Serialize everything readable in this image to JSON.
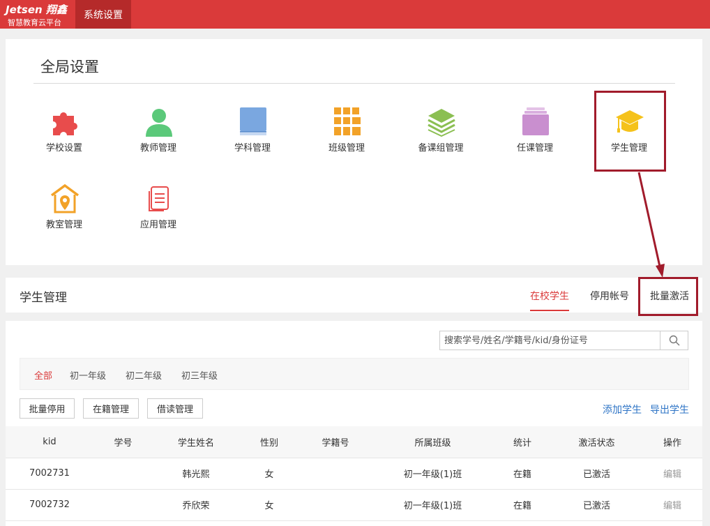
{
  "header": {
    "brand": "Jetsen 翔鑫",
    "subtitle": "智慧教育云平台",
    "nav_tab": "系统设置"
  },
  "global": {
    "title": "全局设置",
    "tiles": [
      {
        "label": "学校设置",
        "icon": "puzzle-icon",
        "color": "#e84c4c"
      },
      {
        "label": "教师管理",
        "icon": "user-icon",
        "color": "#5bc97a"
      },
      {
        "label": "学科管理",
        "icon": "book-icon",
        "color": "#7aa7e0"
      },
      {
        "label": "班级管理",
        "icon": "grid-icon",
        "color": "#f2a228"
      },
      {
        "label": "备课组管理",
        "icon": "layers-icon",
        "color": "#8bbf52"
      },
      {
        "label": "任课管理",
        "icon": "folder-icon",
        "color": "#c98fcf"
      },
      {
        "label": "学生管理",
        "icon": "graduation-cap-icon",
        "color": "#f5c21b"
      },
      {
        "label": "教室管理",
        "icon": "classroom-icon",
        "color": "#f2a228"
      },
      {
        "label": "应用管理",
        "icon": "document-icon",
        "color": "#e84c4c"
      }
    ]
  },
  "student": {
    "title": "学生管理",
    "tabs": [
      "在校学生",
      "停用帐号",
      "批量激活"
    ],
    "search_placeholder": "搜索学号/姓名/学籍号/kid/身份证号",
    "filters": [
      "全部",
      "初一年级",
      "初二年级",
      "初三年级"
    ],
    "buttons": [
      "批量停用",
      "在籍管理",
      "借读管理"
    ],
    "links": [
      "添加学生",
      "导出学生"
    ],
    "columns": [
      "kid",
      "学号",
      "学生姓名",
      "性别",
      "学籍号",
      "所属班级",
      "统计",
      "激活状态",
      "操作"
    ],
    "rows": [
      {
        "kid": "7002731",
        "no": "",
        "name": "韩光熙",
        "gender": "女",
        "reg": "",
        "class": "初一年级(1)班",
        "stat": "在籍",
        "status": "已激活",
        "op": "编辑"
      },
      {
        "kid": "7002732",
        "no": "",
        "name": "乔欣荣",
        "gender": "女",
        "reg": "",
        "class": "初一年级(1)班",
        "stat": "在籍",
        "status": "已激活",
        "op": "编辑"
      }
    ]
  },
  "colors": {
    "accent": "#da3a3a",
    "highlight": "#a11b2b",
    "link": "#2e74c6"
  }
}
